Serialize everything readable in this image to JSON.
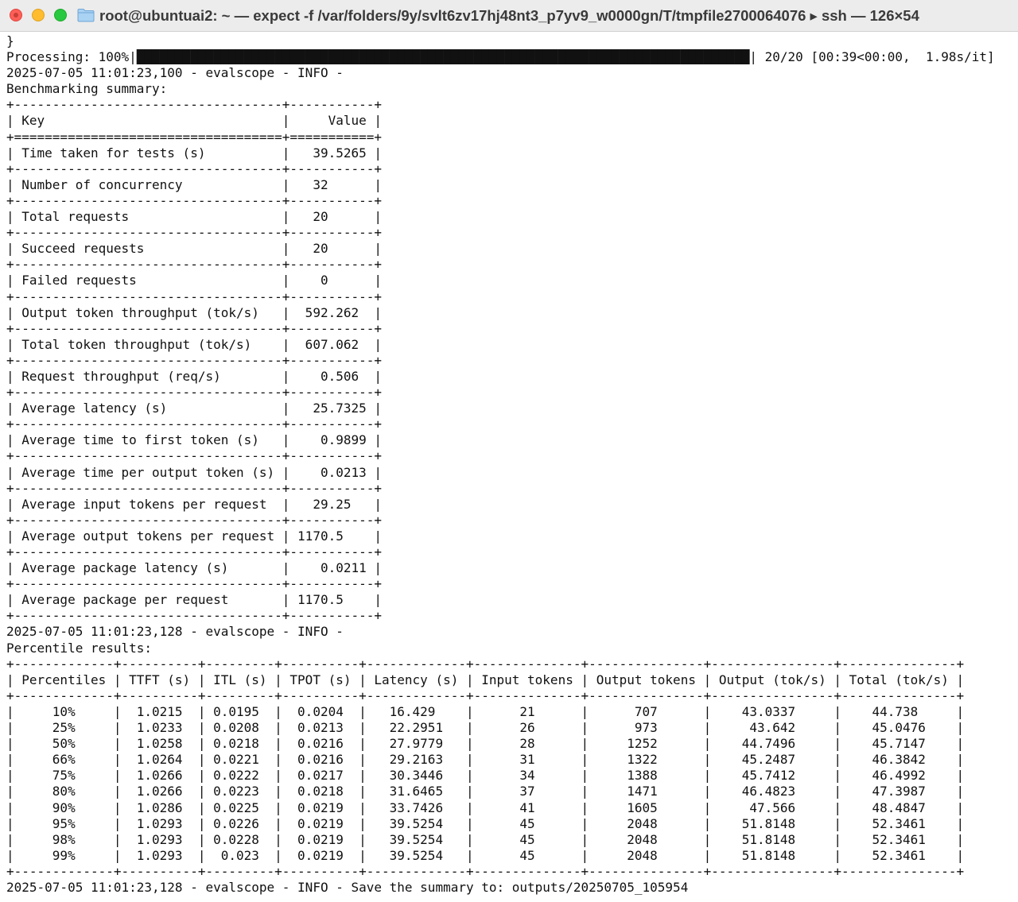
{
  "window": {
    "title": "root@ubuntuai2: ~ — expect -f /var/folders/9y/svlt6zv17hj48nt3_p7yv9_w0000gn/T/tmpfile2700064076 ▸ ssh — 126×54",
    "icons": {
      "close": "close-icon",
      "minimize": "minimize-icon",
      "maximize": "maximize-icon",
      "folder": "folder-icon"
    },
    "colors": {
      "close": "#fe5f57",
      "minimize": "#febc2e",
      "maximize": "#28c840",
      "folder": "#8fc1ea"
    }
  },
  "terminal": {
    "lines": [
      "}",
      "Processing: 100%|████████████████████████████████████████████████████████████████████████████████| 20/20 [00:39<00:00,  1.98s/it]",
      "2025-07-05 11:01:23,100 - evalscope - INFO -",
      "Benchmarking summary:",
      "+-----------------------------------+-----------+",
      "| Key                               |     Value |",
      "+===================================+===========+",
      "| Time taken for tests (s)          |   39.5265 |",
      "+-----------------------------------+-----------+",
      "| Number of concurrency             |   32      |",
      "+-----------------------------------+-----------+",
      "| Total requests                    |   20      |",
      "+-----------------------------------+-----------+",
      "| Succeed requests                  |   20      |",
      "+-----------------------------------+-----------+",
      "| Failed requests                   |    0      |",
      "+-----------------------------------+-----------+",
      "| Output token throughput (tok/s)   |  592.262  |",
      "+-----------------------------------+-----------+",
      "| Total token throughput (tok/s)    |  607.062  |",
      "+-----------------------------------+-----------+",
      "| Request throughput (req/s)        |    0.506  |",
      "+-----------------------------------+-----------+",
      "| Average latency (s)               |   25.7325 |",
      "+-----------------------------------+-----------+",
      "| Average time to first token (s)   |    0.9899 |",
      "+-----------------------------------+-----------+",
      "| Average time per output token (s) |    0.0213 |",
      "+-----------------------------------+-----------+",
      "| Average input tokens per request  |   29.25   |",
      "+-----------------------------------+-----------+",
      "| Average output tokens per request | 1170.5    |",
      "+-----------------------------------+-----------+",
      "| Average package latency (s)       |    0.0211 |",
      "+-----------------------------------+-----------+",
      "| Average package per request       | 1170.5    |",
      "+-----------------------------------+-----------+",
      "2025-07-05 11:01:23,128 - evalscope - INFO -",
      "Percentile results:",
      "+-------------+----------+---------+----------+-------------+--------------+---------------+----------------+---------------+",
      "| Percentiles | TTFT (s) | ITL (s) | TPOT (s) | Latency (s) | Input tokens | Output tokens | Output (tok/s) | Total (tok/s) |",
      "+-------------+----------+---------+----------+-------------+--------------+---------------+----------------+---------------+",
      "|     10%     |  1.0215  | 0.0195  |  0.0204  |   16.429    |      21      |      707      |    43.0337     |    44.738     |",
      "|     25%     |  1.0233  | 0.0208  |  0.0213  |   22.2951   |      26      |      973      |     43.642     |    45.0476    |",
      "|     50%     |  1.0258  | 0.0218  |  0.0216  |   27.9779   |      28      |     1252      |    44.7496     |    45.7147    |",
      "|     66%     |  1.0264  | 0.0221  |  0.0216  |   29.2163   |      31      |     1322      |    45.2487     |    46.3842    |",
      "|     75%     |  1.0266  | 0.0222  |  0.0217  |   30.3446   |      34      |     1388      |    45.7412     |    46.4992    |",
      "|     80%     |  1.0266  | 0.0223  |  0.0218  |   31.6465   |      37      |     1471      |    46.4823     |    47.3987    |",
      "|     90%     |  1.0286  | 0.0225  |  0.0219  |   33.7426   |      41      |     1605      |     47.566     |    48.4847    |",
      "|     95%     |  1.0293  | 0.0226  |  0.0219  |   39.5254   |      45      |     2048      |    51.8148     |    52.3461    |",
      "|     98%     |  1.0293  | 0.0228  |  0.0219  |   39.5254   |      45      |     2048      |    51.8148     |    52.3461    |",
      "|     99%     |  1.0293  |  0.023  |  0.0219  |   39.5254   |      45      |     2048      |    51.8148     |    52.3461    |",
      "+-------------+----------+---------+----------+-------------+--------------+---------------+----------------+---------------+",
      "2025-07-05 11:01:23,128 - evalscope - INFO - Save the summary to: outputs/20250705_105954"
    ]
  }
}
